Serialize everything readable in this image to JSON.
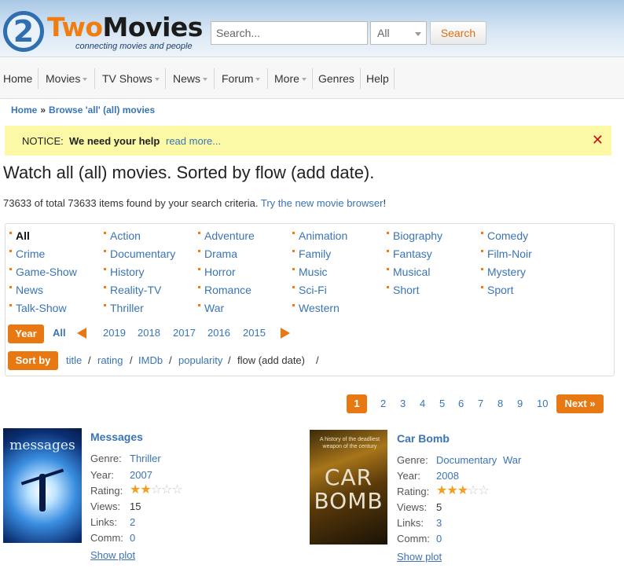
{
  "brand": {
    "word_two": "Two",
    "word_movies": "Movies",
    "digit": "2",
    "tagline": "connecting movies and people"
  },
  "search": {
    "placeholder": "Search...",
    "select_value": "All",
    "button": "Search"
  },
  "nav": [
    {
      "label": "Home",
      "dropdown": false
    },
    {
      "label": "Movies",
      "dropdown": true
    },
    {
      "label": "TV Shows",
      "dropdown": true
    },
    {
      "label": "News",
      "dropdown": true
    },
    {
      "label": "Forum",
      "dropdown": true
    },
    {
      "label": "More",
      "dropdown": true
    },
    {
      "label": "Genres",
      "dropdown": false
    },
    {
      "label": "Help",
      "dropdown": false
    }
  ],
  "breadcrumb": {
    "home": "Home",
    "separator": "»",
    "current": "Browse 'all' (all) movies"
  },
  "notice": {
    "label": "NOTICE:",
    "text": "We need your help",
    "link": "read more...",
    "close": "✕"
  },
  "page_title": "Watch all (all) movies. Sorted by flow (add date).",
  "found": {
    "text": "73633 of total 73633 items found by your search criteria.",
    "link": "Try the new movie browser",
    "suffix": "!"
  },
  "genres": [
    "All",
    "Action",
    "Adventure",
    "Animation",
    "Biography",
    "Comedy",
    "Crime",
    "Documentary",
    "Drama",
    "Family",
    "Fantasy",
    "Film-Noir",
    "Game-Show",
    "History",
    "Horror",
    "Music",
    "Musical",
    "Mystery",
    "News",
    "Reality-TV",
    "Romance",
    "Sci-Fi",
    "Short",
    "Sport",
    "Talk-Show",
    "Thriller",
    "War",
    "Western"
  ],
  "year": {
    "label": "Year",
    "all": "All",
    "years": [
      "2019",
      "2018",
      "2017",
      "2016",
      "2015"
    ]
  },
  "sort": {
    "label": "Sort by",
    "options": [
      "title",
      "rating",
      "IMDb",
      "popularity",
      "flow (add date)"
    ],
    "separator": "/"
  },
  "pagination": {
    "pages": [
      "1",
      "2",
      "3",
      "4",
      "5",
      "6",
      "7",
      "8",
      "9",
      "10"
    ],
    "current": "1",
    "next": "Next »"
  },
  "labels": {
    "genre": "Genre:",
    "year": "Year:",
    "rating": "Rating:",
    "views": "Views:",
    "links": "Links:",
    "comm": "Comm:",
    "show_plot": "Show plot"
  },
  "movies": [
    {
      "title": "Messages",
      "genres": [
        "Thriller"
      ],
      "year": "2007",
      "rating_stars": 2,
      "max_stars": 5,
      "views": "15",
      "links": "2",
      "comm": "0",
      "poster_text": "messages"
    },
    {
      "title": "Car Bomb",
      "genres": [
        "Documentary",
        "War"
      ],
      "year": "2008",
      "rating_stars": 3,
      "max_stars": 5,
      "views": "5",
      "links": "3",
      "comm": "0",
      "poster_text_1": "CAR",
      "poster_text_2": "BOMB",
      "poster_tagline": "A history of the deadliest weapon of the century"
    }
  ],
  "colors": {
    "accent": "#e87912",
    "link": "#3a74b5",
    "notice_bg": "#fbf9a5",
    "close": "#cc1111"
  }
}
